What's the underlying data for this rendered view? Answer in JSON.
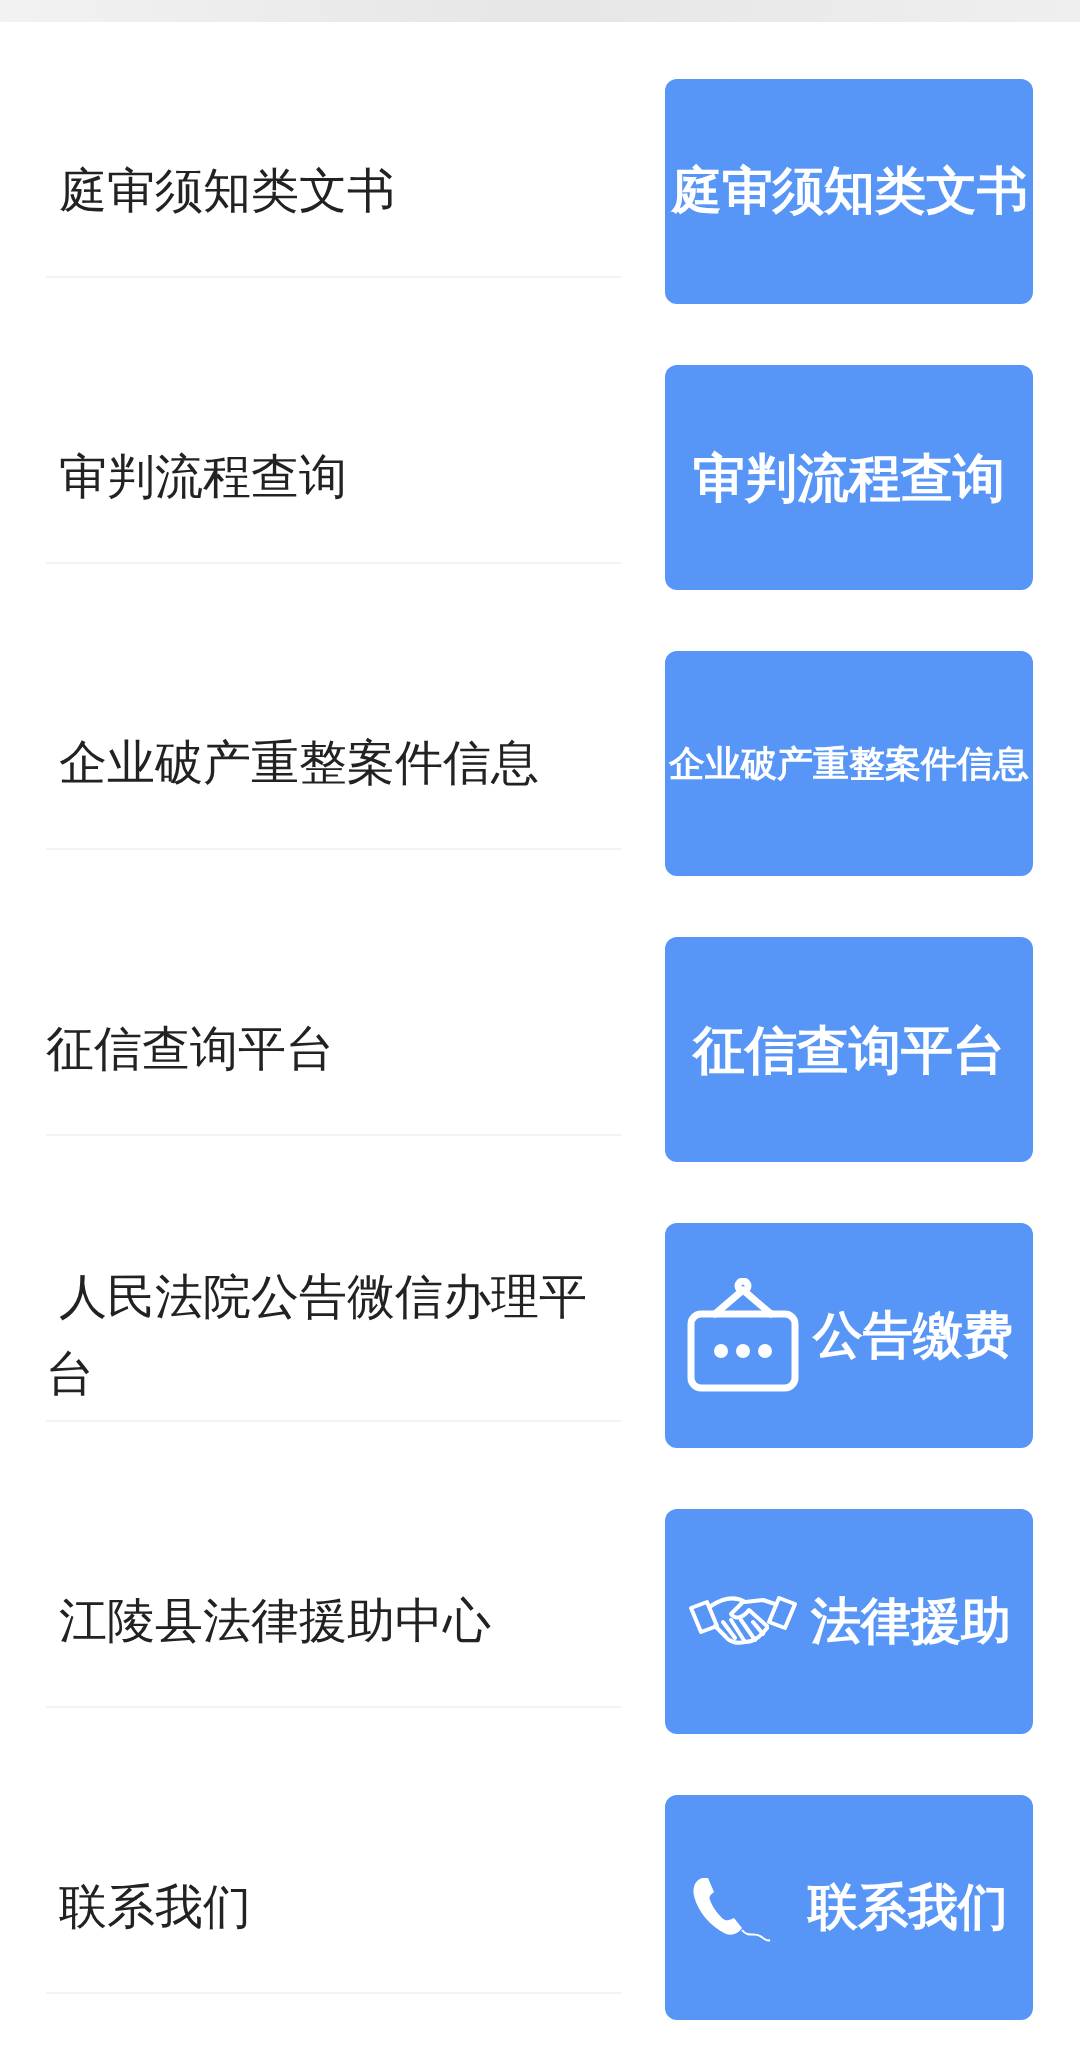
{
  "items": [
    {
      "label": " 庭审须知类文书",
      "card": {
        "kind": "text",
        "text": "庭审须知类文书"
      }
    },
    {
      "label": " 审判流程查询",
      "card": {
        "kind": "text",
        "text": "审判流程查询"
      }
    },
    {
      "label": " 企业破产重整案件信息",
      "card": {
        "kind": "text",
        "text": "企业破产重整案件信息"
      }
    },
    {
      "label": "征信查询平台",
      "card": {
        "kind": "text",
        "text": "征信查询平台"
      }
    },
    {
      "label": " 人民法院公告微信办理平台",
      "card": {
        "kind": "sign",
        "text": "公告缴费"
      }
    },
    {
      "label": " 江陵县法律援助中心",
      "card": {
        "kind": "handshake",
        "text": "法律援助"
      }
    },
    {
      "label": " 联系我们",
      "card": {
        "kind": "phone",
        "text": "联系我们"
      }
    }
  ]
}
